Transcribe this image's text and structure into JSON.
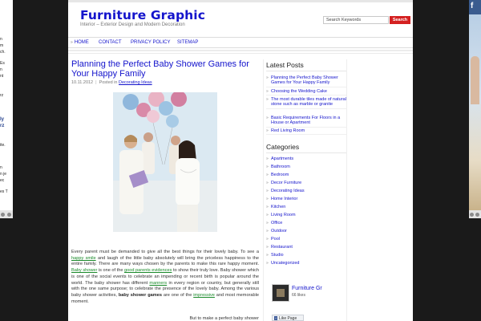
{
  "site": {
    "title": "Furniture Graphic",
    "tagline": "Interior – Exterior Design and Modern Decoration"
  },
  "search": {
    "placeholder": "Search Keywords",
    "button_label": "Search"
  },
  "nav": {
    "items": [
      "HOME",
      "CONTACT",
      "PRIVACY POLICY",
      "SITEMAP"
    ]
  },
  "post": {
    "title": "Planning the Perfect Baby Shower Games for Your Happy Family",
    "date": "10.11.2012",
    "posted_in_label": "Posted in",
    "category": "Decorating Ideas",
    "body": {
      "p1_a": "Every parent must be demanded to give all the best things for their lovely baby. To see a ",
      "link1": "happy smile",
      "p1_b": " and laugh of the little baby absolutely will bring the priceless happiness to the entire family. There are many ways chosen by the parents to make this rare happy moment. ",
      "link2": "Baby shower",
      "p1_c": " is one of the ",
      "link3": "good parents evidences",
      "p1_d": " to show their truly love. Baby shower which is one of the social events to celebrate an impending or recent birth is popular around the world. The baby shower has different ",
      "link4": "manners",
      "p1_e": " in every region or country, but generally still with the one same purpose; to celebrate the presence of the lovely baby. Among the various baby shower activities, ",
      "bold1": "baby shower games",
      "p1_f": " are one of the ",
      "link5": "impressive",
      "p1_g": " and most memorable moment.",
      "tail": "But to make a perfect baby shower"
    }
  },
  "sidebar": {
    "latest_posts_title": "Latest Posts",
    "latest_posts": [
      "Planning the Perfect Baby Shower Games for Your Happy Family",
      "Choosing the Wedding Cake",
      "The most durable tiles made of natural stone such as marble or granite",
      "Basic Requirements For Floors in a House or Apartment",
      "Red Living Room"
    ],
    "categories_title": "Categories",
    "categories": [
      "Apartments",
      "Bathroom",
      "Bedroom",
      "Decor Furniture",
      "Decorating Ideas",
      "Home Interior",
      "Kitchen",
      "Living Room",
      "Office",
      "Outdoor",
      "Pool",
      "Restaurant",
      "Studio",
      "Uncategorized"
    ],
    "facebook": {
      "page_name": "Furniture Gr",
      "likes": "66 likes",
      "like_button": "Like Page",
      "logo_letter": "f"
    }
  },
  "side_ads": {
    "left_fragments": [
      "n",
      "m",
      "ch.",
      "Es",
      "n",
      "nt",
      "rz",
      "ly",
      "rz",
      "ite.",
      "n",
      "n je",
      "ec",
      "es T"
    ],
    "right_logo": "f"
  },
  "colors": {
    "link": "#1414cc",
    "search_button": "#d42121",
    "inline_link": "#1a8a2a"
  }
}
